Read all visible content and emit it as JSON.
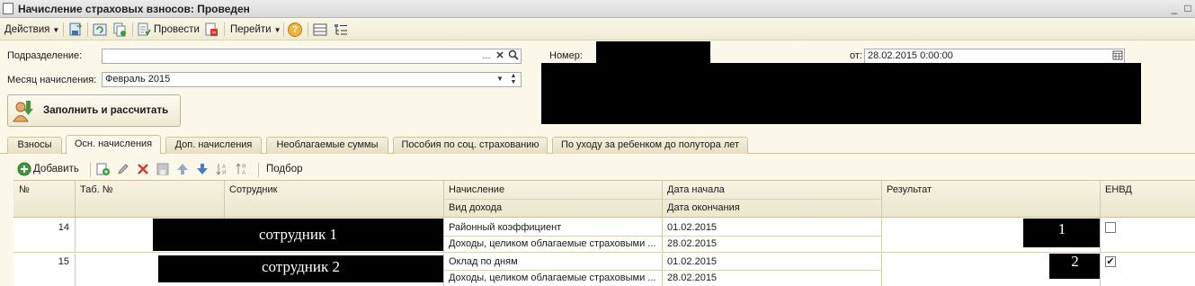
{
  "window": {
    "title": "Начисление страховых взносов: Проведен",
    "minimize": "_",
    "maximize": "□"
  },
  "toolbar": {
    "actions": "Действия",
    "post": "Провести",
    "goto": "Перейти",
    "help": "?"
  },
  "form": {
    "department_label": "Подразделение:",
    "department_value": "",
    "department_select": "...",
    "month_label": "Месяц начисления:",
    "month_value": "Февраль 2015",
    "number_label": "Номер:",
    "date_label": "от:",
    "date_value": "28.02.2015  0:00:00",
    "fill_button": "Заполнить и рассчитать"
  },
  "tabs": [
    {
      "label": "Взносы"
    },
    {
      "label": "Осн. начисления",
      "active": true
    },
    {
      "label": "Доп. начисления"
    },
    {
      "label": "Необлагаемые суммы"
    },
    {
      "label": "Пособия по соц. страхованию"
    },
    {
      "label": "По уходу за ребенком до полутора лет"
    }
  ],
  "subtoolbar": {
    "add": "Добавить",
    "pick": "Подбор"
  },
  "grid": {
    "headers": {
      "num": "№",
      "tab_num": "Таб. №",
      "employee": "Сотрудник",
      "accrual": "Начисление",
      "income_type": "Вид дохода",
      "date_start": "Дата начала",
      "date_end": "Дата окончания",
      "result": "Результат",
      "envd": "ЕНВД"
    },
    "rows": [
      {
        "num": "14",
        "employee": "сотрудник 1",
        "accrual": "Районный коэффициент",
        "income_type": "Доходы, целиком облагаемые страховыми ...",
        "date_start": "01.02.2015",
        "date_end": "28.02.2015",
        "result": "1",
        "envd_checked": false
      },
      {
        "num": "15",
        "employee": "сотрудник 2",
        "accrual": "Оклад по дням",
        "income_type": "Доходы, целиком облагаемые страховыми ...",
        "date_start": "01.02.2015",
        "date_end": "28.02.2015",
        "result": "2",
        "envd_checked": true
      }
    ]
  },
  "colors": {
    "panel_bg": "#fbf8ea",
    "toolbar_bg": "#f0ebd5",
    "border": "#c9c2a3",
    "redaction": "#000000",
    "delete_red": "#d43a2f",
    "add_green": "#3e9a3a",
    "arrow_blue": "#3f7fd0"
  }
}
